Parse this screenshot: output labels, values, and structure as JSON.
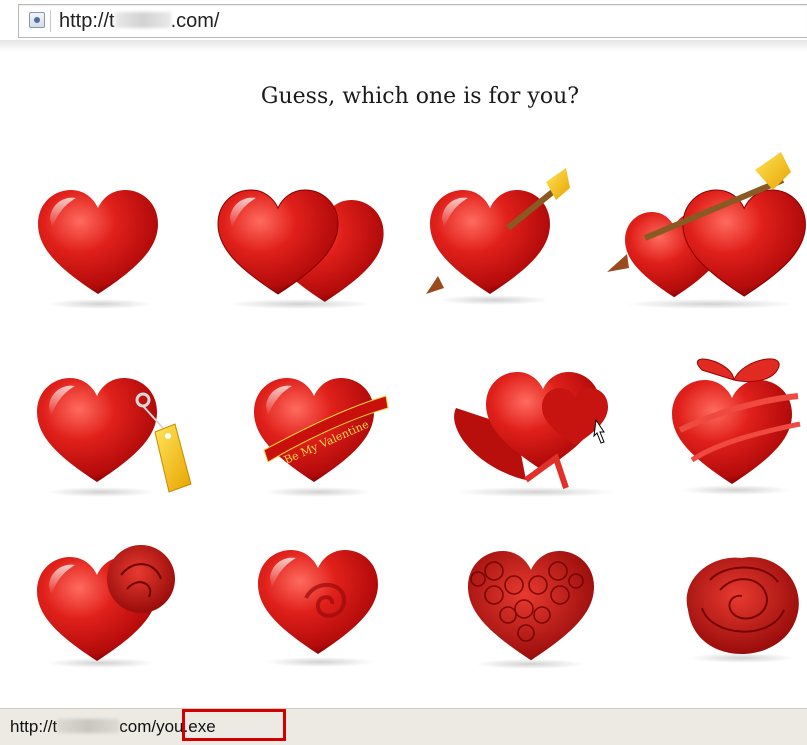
{
  "browser": {
    "url_prefix": "http://t",
    "url_suffix": ".com/"
  },
  "page": {
    "title": "Guess, which one is for you?"
  },
  "icons": [
    {
      "name": "heart-icon"
    },
    {
      "name": "double-heart-icon"
    },
    {
      "name": "heart-arrow-icon"
    },
    {
      "name": "double-heart-arrow-icon"
    },
    {
      "name": "heart-tag-icon"
    },
    {
      "name": "heart-banner-icon",
      "banner_text": "Be My Valentine"
    },
    {
      "name": "heart-gift-box-icon"
    },
    {
      "name": "heart-ribbon-icon"
    },
    {
      "name": "heart-rose-icon"
    },
    {
      "name": "heart-swirl-icon"
    },
    {
      "name": "rose-heart-icon"
    },
    {
      "name": "rose-icon"
    }
  ],
  "status": {
    "prefix": "http://t",
    "mid": "co",
    "suffix": "m/you.exe"
  },
  "colors": {
    "heart_red": "#d41a16",
    "heart_dark": "#8a0000",
    "highlight": "#d40000",
    "status_bg": "#eceae3"
  }
}
